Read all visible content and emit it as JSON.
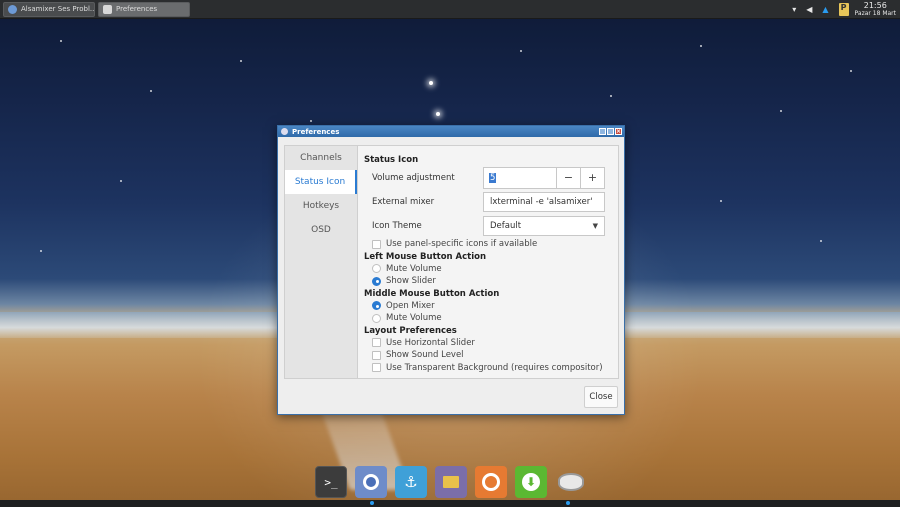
{
  "taskbar": {
    "tasks": [
      {
        "label": "Alsamixer Ses Probl...",
        "active": false
      },
      {
        "label": "Preferences",
        "active": true
      }
    ],
    "tray": {
      "notes_label": "P",
      "clock_time": "21:56",
      "clock_date": "Pazar 18 Mart"
    }
  },
  "window": {
    "title": "Preferences",
    "tabs": [
      "Channels",
      "Status Icon",
      "Hotkeys",
      "OSD"
    ],
    "active_tab": "Status Icon",
    "status_icon": {
      "heading": "Status Icon",
      "volume_adjustment_label": "Volume adjustment",
      "volume_adjustment_value": "5",
      "minus": "−",
      "plus": "+",
      "external_mixer_label": "External mixer",
      "external_mixer_value": "lxterminal -e 'alsamixer'",
      "icon_theme_label": "Icon Theme",
      "icon_theme_value": "Default",
      "panel_specific_label": "Use panel-specific icons if available",
      "panel_specific_checked": false
    },
    "left_mouse": {
      "heading": "Left Mouse Button Action",
      "options": [
        {
          "label": "Mute Volume",
          "selected": false
        },
        {
          "label": "Show Slider",
          "selected": true
        }
      ]
    },
    "middle_mouse": {
      "heading": "Middle Mouse Button Action",
      "options": [
        {
          "label": "Open Mixer",
          "selected": true
        },
        {
          "label": "Mute Volume",
          "selected": false
        }
      ]
    },
    "layout": {
      "heading": "Layout Preferences",
      "options": [
        {
          "label": "Use Horizontal Slider",
          "checked": false
        },
        {
          "label": "Show Sound Level",
          "checked": false
        },
        {
          "label": "Use Transparent Background (requires compositor)",
          "checked": false
        }
      ]
    },
    "close_label": "Close"
  },
  "dock": {
    "terminal_glyph": ">_",
    "anchor_glyph": "⚓",
    "download_glyph": "⬇",
    "items": [
      "terminal-icon",
      "chromium-icon",
      "anchor-icon",
      "files-icon",
      "disc-icon",
      "download-icon",
      "disk-icon"
    ]
  },
  "colors": {
    "accent": "#2a7bd2",
    "titlebar": "#3a78b8",
    "panel": "#2b2d2f"
  }
}
